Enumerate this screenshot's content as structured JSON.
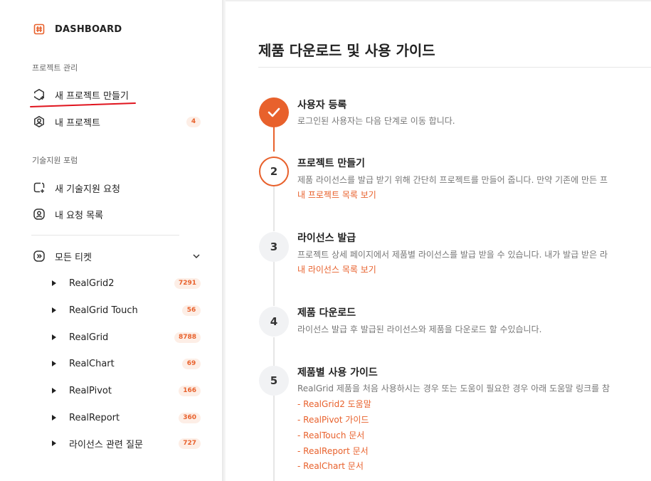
{
  "sidebar": {
    "brand": {
      "icon": "hash-square-icon",
      "label": "DASHBOARD"
    },
    "sections": {
      "project_label": "프로젝트 관리",
      "new_project": {
        "label": "새 프로젝트 만들기",
        "icon": "hexagon-plus-icon"
      },
      "my_projects": {
        "label": "내 프로젝트",
        "icon": "user-hexagon-icon",
        "badge": "4"
      },
      "forum_label": "기술지원 포럼",
      "new_support": {
        "label": "새 기술지원 요청",
        "icon": "chat-plus-icon"
      },
      "my_requests": {
        "label": "내 요청 목록",
        "icon": "user-circle-icon"
      },
      "all_tickets": {
        "label": "모든 티켓",
        "icon": "chevron-right-circle-icon",
        "toggle": "chevron-down-icon"
      }
    },
    "tickets": [
      {
        "label": "RealGrid2",
        "badge": "7291"
      },
      {
        "label": "RealGrid Touch",
        "badge": "56"
      },
      {
        "label": "RealGrid",
        "badge": "8788"
      },
      {
        "label": "RealChart",
        "badge": "69"
      },
      {
        "label": "RealPivot",
        "badge": "166"
      },
      {
        "label": "RealReport",
        "badge": "360"
      },
      {
        "label": "라이선스 관련 질문",
        "badge": "727"
      }
    ]
  },
  "main": {
    "title": "제품 다운로드 및 사용 가이드",
    "steps": [
      {
        "marker": "✓",
        "status": "done",
        "title": "사용자 등록",
        "desc": "로그인된 사용자는 다음 단계로 이동 합니다."
      },
      {
        "marker": "2",
        "status": "active",
        "title": "프로젝트 만들기",
        "desc": "제품 라이선스를 발급 받기 위해 간단히 프로젝트를 만들어 줍니다. 만약 기존에 만든 프",
        "link": "내 프로젝트 목록 보기"
      },
      {
        "marker": "3",
        "status": "pending",
        "title": "라이선스 발급",
        "desc": "프로젝트 상세 페이지에서 제품별 라이선스를 발급 받을 수 있습니다. 내가 발급 받은 라",
        "link": "내 라이선스 목록 보기"
      },
      {
        "marker": "4",
        "status": "pending",
        "title": "제품 다운로드",
        "desc": "라이선스 발급 후 발급된 라이선스와 제품을 다운로드 할 수있습니다."
      },
      {
        "marker": "5",
        "status": "pending",
        "title": "제품별 사용 가이드",
        "desc": "RealGrid 제품을 처음 사용하시는 경우 또는 도움이 필요한 경우 아래 도움말 링크를 참",
        "links": [
          "- RealGrid2 도움말",
          "- RealPivot 가이드",
          "- RealTouch 문서",
          "- RealReport 문서",
          "- RealChart 문서"
        ]
      }
    ]
  },
  "colors": {
    "accent": "#e8612c",
    "badge_bg": "#fdeee6",
    "pending_bg": "#f1f2f4",
    "annotation": "#e0141e"
  }
}
